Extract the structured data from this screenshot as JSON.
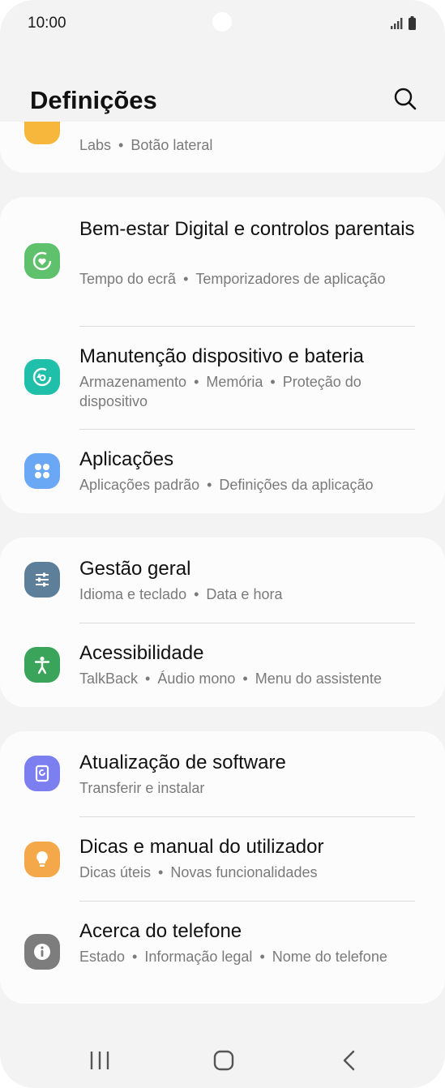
{
  "status": {
    "time": "10:00"
  },
  "header": {
    "title": "Definições"
  },
  "partial_item": {
    "subtitle_parts": [
      "Labs",
      "Botão lateral"
    ],
    "icon": "advanced-features-icon",
    "color": "#f6b73c"
  },
  "cards": [
    {
      "items": [
        {
          "title": "Bem-estar Digital e controlos parentais",
          "subtitle_parts": [
            "Tempo do ecrã",
            "Temporizadores de aplicação"
          ],
          "icon": "digital-wellbeing-icon",
          "color": "#5fc16c"
        },
        {
          "title": "Manutenção dispositivo e bateria",
          "subtitle_parts": [
            "Armazenamento",
            "Memória",
            "Proteção do dispositivo"
          ],
          "icon": "device-care-icon",
          "color": "#1fbfa9"
        },
        {
          "title": "Aplicações",
          "subtitle_parts": [
            "Aplicações padrão",
            "Definições da aplicação"
          ],
          "icon": "apps-icon",
          "color": "#6aa8f5"
        }
      ]
    },
    {
      "items": [
        {
          "title": "Gestão geral",
          "subtitle_parts": [
            "Idioma e teclado",
            "Data e hora"
          ],
          "icon": "general-management-icon",
          "color": "#5d7f99"
        },
        {
          "title": "Acessibilidade",
          "subtitle_parts": [
            "TalkBack",
            "Áudio mono",
            "Menu do assistente"
          ],
          "icon": "accessibility-icon",
          "color": "#3aa55a"
        }
      ]
    },
    {
      "items": [
        {
          "title": "Atualização de software",
          "subtitle_parts": [
            "Transferir e instalar"
          ],
          "icon": "software-update-icon",
          "color": "#7b7ff0"
        },
        {
          "title": "Dicas e manual do utilizador",
          "subtitle_parts": [
            "Dicas úteis",
            "Novas funcionalidades"
          ],
          "icon": "tips-icon",
          "color": "#f5a84a"
        },
        {
          "title": "Acerca do telefone",
          "subtitle_parts": [
            "Estado",
            "Informação legal",
            "Nome do telefone"
          ],
          "icon": "about-phone-icon",
          "color": "#7d7d7d"
        }
      ]
    }
  ],
  "nav": {
    "recents": "recent-apps-icon",
    "home": "home-icon",
    "back": "back-icon"
  }
}
